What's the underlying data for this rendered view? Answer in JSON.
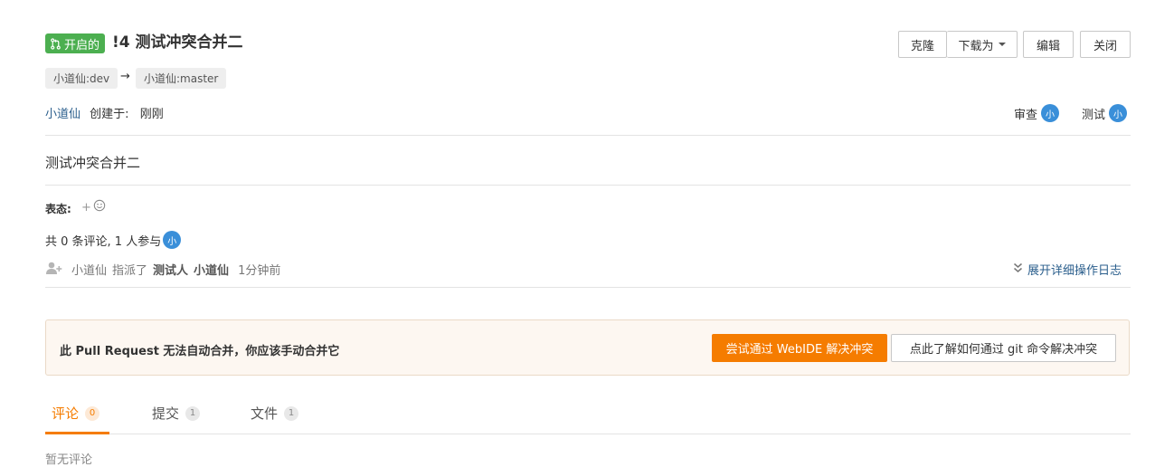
{
  "header": {
    "status": "开启的",
    "title": "!4 测试冲突合并二"
  },
  "toolbar": {
    "clone": "克隆",
    "download": "下载为",
    "edit": "编辑",
    "close": "关闭"
  },
  "branches": {
    "source": "小道仙:dev",
    "arrow": "→",
    "target": "小道仙:master"
  },
  "meta": {
    "author": "小道仙",
    "created_label": "创建于:",
    "created_time": "刚刚"
  },
  "reviewers": [
    {
      "role": "审查",
      "avatar": "小"
    },
    {
      "role": "测试",
      "avatar": "小"
    }
  ],
  "description": "测试冲突合并二",
  "reactions": {
    "label": "表态:",
    "add": "+"
  },
  "summary": {
    "text": "共 0 条评论, 1 人参与",
    "avatar": "小"
  },
  "activity": {
    "actor": "小道仙",
    "action": "指派了",
    "target1": "测试人",
    "target2": "小道仙",
    "time": "1分钟前",
    "expand_label": "展开详细操作日志"
  },
  "merge_notice": {
    "message": "此 Pull Request 无法自动合并，你应该手动合并它",
    "webide_button": "尝试通过 WebIDE 解决冲突",
    "git_button": "点此了解如何通过 git 命令解决冲突"
  },
  "tabs": [
    {
      "label": "评论",
      "count": "0"
    },
    {
      "label": "提交",
      "count": "1"
    },
    {
      "label": "文件",
      "count": "1"
    }
  ],
  "comments": {
    "empty_text": "暂无评论"
  },
  "colors": {
    "status_green": "#4caf50",
    "accent_orange": "#f57c00",
    "avatar_blue": "#3a8fd9",
    "link_blue": "#2a5e8c"
  }
}
